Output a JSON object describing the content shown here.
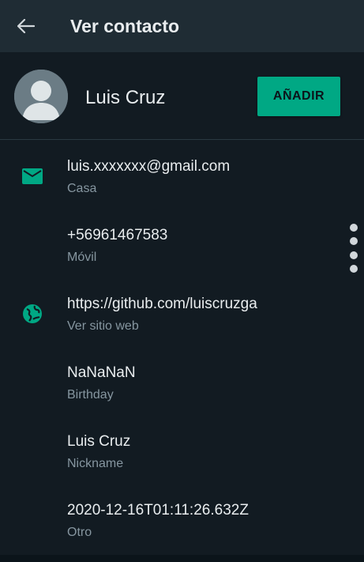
{
  "appbar": {
    "title": "Ver contacto",
    "back_icon": "arrow-left-icon"
  },
  "contact": {
    "name": "Luis Cruz",
    "avatar_icon": "default-avatar-icon",
    "add_label": "AÑADIR"
  },
  "details": [
    {
      "icon": "email-icon",
      "primary": "luis.xxxxxxx@gmail.com",
      "secondary": "Casa"
    },
    {
      "icon": "",
      "primary": "+56961467583",
      "secondary": "Móvil"
    },
    {
      "icon": "globe-icon",
      "primary": "https://github.com/luiscruzga",
      "secondary": "Ver sitio web"
    },
    {
      "icon": "",
      "primary": "NaNaNaN",
      "secondary": "Birthday"
    },
    {
      "icon": "",
      "primary": "Luis Cruz",
      "secondary": "Nickname"
    },
    {
      "icon": "",
      "primary": "2020-12-16T01:11:26.632Z",
      "secondary": "Otro"
    }
  ],
  "colors": {
    "background": "#121b22",
    "appbar": "#1f2c34",
    "accent": "#00a884",
    "text_primary": "#e9edef",
    "text_secondary": "#8696a0"
  }
}
